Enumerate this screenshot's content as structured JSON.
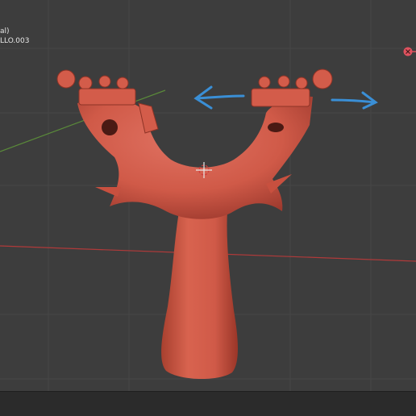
{
  "viewport": {
    "view_label": "al)",
    "object_label": "LLO.003",
    "colors": {
      "background": "#3d3d3d",
      "grid": "#464646",
      "x_axis": "#b03a3a",
      "y_axis": "#5a8a3a",
      "model": "#d65f4e",
      "model_shadow": "#9e3a2e",
      "annotation_arrow": "#3a8fd6",
      "gizmo": "#e0525f"
    },
    "icons": {
      "origin_cursor": "3d-cursor-icon",
      "navigation_gizmo": "gizmo-x-icon"
    }
  }
}
